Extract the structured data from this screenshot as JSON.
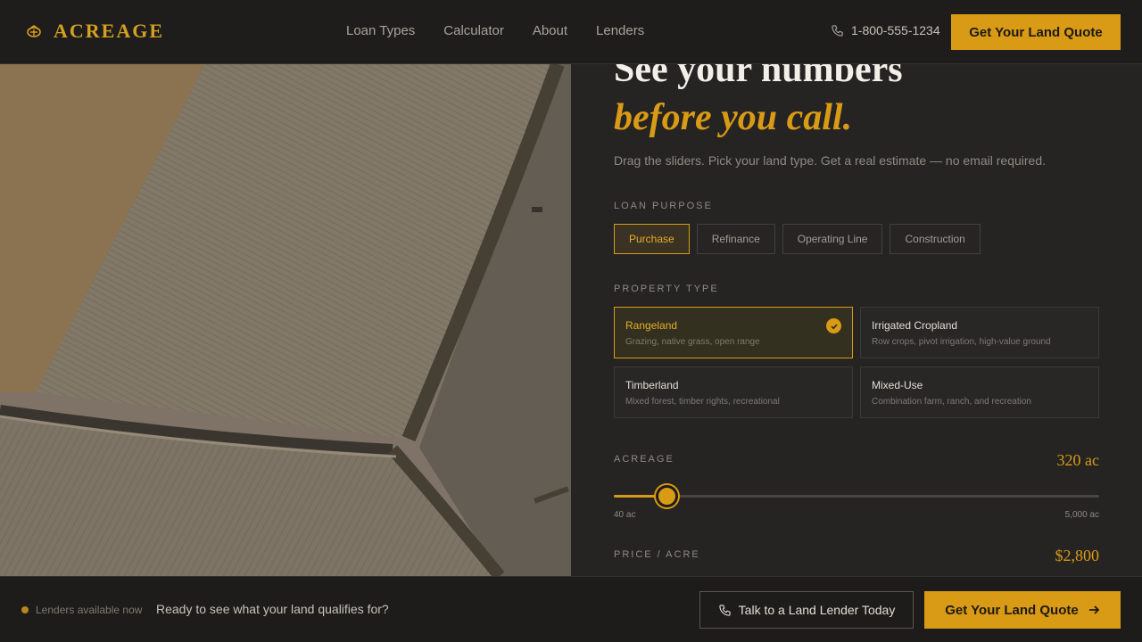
{
  "header": {
    "brand": "ACREAGE",
    "logo_icon": "wheat-logo-icon",
    "nav": [
      "Loan Types",
      "Calculator",
      "About",
      "Lenders"
    ],
    "phone": "1-800-555-1234",
    "phone_icon": "phone-icon",
    "cta": "Get Your Land Quote"
  },
  "hero_image": {
    "icon": "aerial-farmland-photo"
  },
  "calculator": {
    "heading_line1": "See your numbers",
    "heading_line2": "before you call.",
    "subheading": "Drag the sliders. Pick your land type. Get a real estimate — no email required.",
    "loan_purpose": {
      "label": "LOAN PURPOSE",
      "options": [
        "Purchase",
        "Refinance",
        "Operating Line",
        "Construction"
      ],
      "selected": "Purchase"
    },
    "property_type": {
      "label": "PROPERTY TYPE",
      "options": [
        {
          "title": "Rangeland",
          "desc": "Grazing, native grass, open range",
          "selected": true
        },
        {
          "title": "Irrigated Cropland",
          "desc": "Row crops, pivot irrigation, high-value ground",
          "selected": false
        },
        {
          "title": "Timberland",
          "desc": "Mixed forest, timber rights, recreational",
          "selected": false
        },
        {
          "title": "Mixed-Use",
          "desc": "Combination farm, ranch, and recreation",
          "selected": false
        }
      ]
    },
    "acreage": {
      "label": "ACREAGE",
      "value_display": "320 ac",
      "value": 320,
      "min": 40,
      "max": 5000,
      "min_label": "40 ac",
      "max_label": "5,000 ac"
    },
    "price_per_acre": {
      "label": "PRICE / ACRE",
      "value_display": "$2,800"
    }
  },
  "footer_bar": {
    "status": "Lenders available now",
    "prompt": "Ready to see what your land qualifies for?",
    "talk_button": "Talk to a Land Lender Today",
    "quote_button": "Get Your Land Quote",
    "arrow_icon": "arrow-right-icon"
  },
  "colors": {
    "accent": "#d99a16",
    "background": "#242322",
    "header_bg": "#1e1d1b",
    "text_light": "#f2efe9",
    "text_muted": "#8f8a82"
  }
}
